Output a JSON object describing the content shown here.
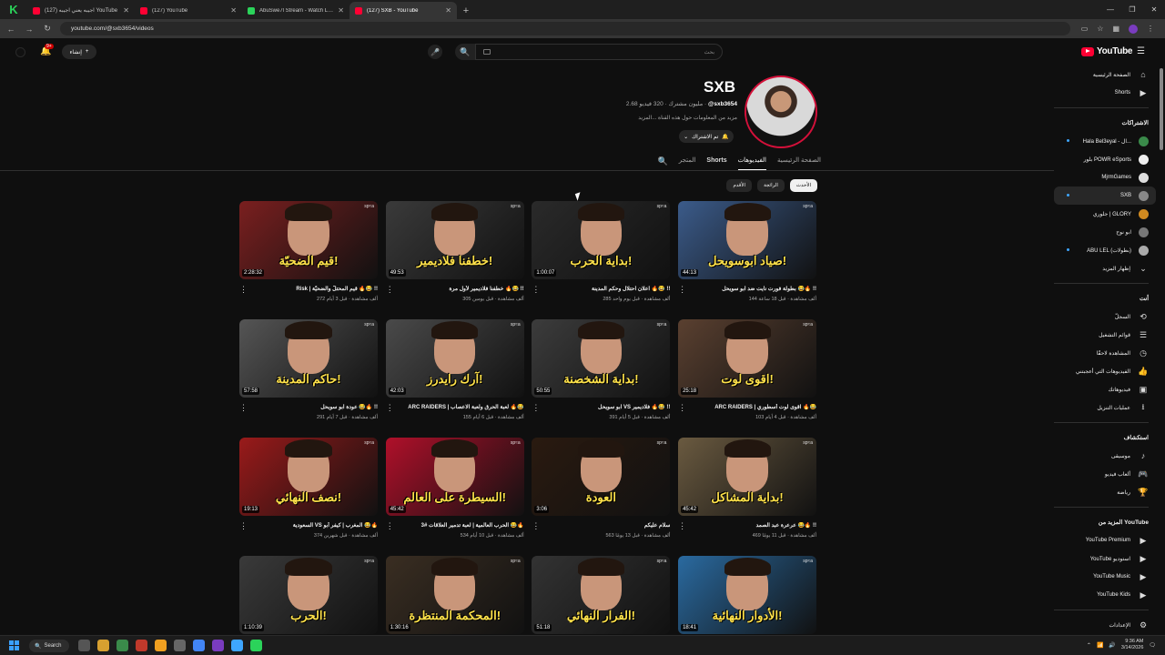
{
  "browser": {
    "tabs": [
      {
        "title": "اجيبه يعني اجيبه (127) YouTube",
        "active": false
      },
      {
        "title": "(127) YouTube",
        "active": false
      },
      {
        "title": "AbuSwe7l Stream - Watch Live",
        "active": false
      },
      {
        "title": "(127) SXB - YouTube",
        "active": true
      }
    ],
    "url": "youtube.com/@sxb3654/videos"
  },
  "header": {
    "create_label": "إنشاء",
    "notif_count": "9+",
    "search_placeholder": "بحث",
    "logo_text": "YouTube",
    "logo_sup": "SA"
  },
  "channel": {
    "name": "SXB",
    "handle": "@sxb3654",
    "stats": "2.68 مليون مشترك · 320 فيديو",
    "description": "مزيد من المعلومات حول هذه القناة ...المزيد",
    "subscribed_label": "تم الاشتراك",
    "tabs": [
      "الصفحة الرئيسية",
      "الفيديوهات",
      "Shorts",
      "المتجر"
    ],
    "active_tab": "الفيديوهات"
  },
  "filters": [
    "الأحدث",
    "الرائجة",
    "الأقدم"
  ],
  "videos": [
    {
      "title": "Risk | قيم المحتلّ والضحيّة 🔥😂 !!",
      "meta": "272 ألف مشاهدة · قبل 3 أيام",
      "duration": "2:28:32",
      "caption": "قيم الضحيّة!",
      "bg": "#7a1f1f"
    },
    {
      "title": "خطفنا فلاديمير لأول مرة 🔥😂 !!",
      "meta": "305 ألف مشاهدة · قبل يومين",
      "duration": "49:53",
      "caption": "خطفنا فلاديمير!",
      "bg": "#3a3a3a"
    },
    {
      "title": "اعلان احتلال وحكم المدينة 🔥😂 !!",
      "meta": "285 ألف مشاهدة · قبل يوم واحد",
      "duration": "1:00:07",
      "caption": "بداية الحرب!",
      "bg": "#2a2a2a"
    },
    {
      "title": "بطولة فورت نايت ضد ابو سويحل 😂🔥 !!",
      "meta": "144 ألف مشاهدة · قبل 18 ساعة",
      "duration": "44:13",
      "caption": "صياد ابوسويحل!",
      "bg": "#3b5b8a"
    },
    {
      "title": "عودة ابو سويحل 😂🔥 !!",
      "meta": "291 ألف مشاهدة · قبل 7 أيام",
      "duration": "57:58",
      "caption": "حاكم المدينة!",
      "bg": "#555555"
    },
    {
      "title": "ARC RAIDERS | لعبة الحرق ولعبة الاعصاب 🔥😂",
      "meta": "155 ألف مشاهدة · قبل 6 أيام",
      "duration": "42:03",
      "caption": "آرك رايدرز!",
      "bg": "#4a4a4a"
    },
    {
      "title": "ابو سويحل VS فلاديمير 🔥😂 !!",
      "meta": "391 ألف مشاهدة · قبل 5 أيام",
      "duration": "50:55",
      "caption": "بداية الشخصنة!",
      "bg": "#3c3c3c"
    },
    {
      "title": "ARC RAIDERS | اقوى لوت أسطوري 🔥😂",
      "meta": "103 ألف مشاهدة · قبل 4 أيام",
      "duration": "25:18",
      "caption": "اقوى لوت!",
      "bg": "#5a4030"
    },
    {
      "title": "السعودية VS المغرب | كيفر أبو 😂🔥",
      "meta": "374 ألف مشاهدة · قبل شهرين",
      "duration": "19:13",
      "caption": "نصف النهائي!",
      "bg": "#9a1a1a"
    },
    {
      "title": "3# الحرب العالمية | لعبة تدمير العلاقات 😂🔥",
      "meta": "534 ألف مشاهدة · قبل 10 أيام",
      "duration": "45:42",
      "caption": "السيطرة على العالم!",
      "bg": "#b0102a"
    },
    {
      "title": "سلام عليكم",
      "meta": "563 ألف مشاهدة · قبل 13 يومًا",
      "duration": "3:06",
      "caption": "العودة",
      "bg": "#2a1a10"
    },
    {
      "title": "عرعرة عبد الصمد 😂🔥 !!",
      "meta": "469 ألف مشاهدة · قبل 11 يومًا",
      "duration": "45:42",
      "caption": "بداية المشاكل!",
      "bg": "#6a5a40"
    },
    {
      "title": "",
      "meta": "",
      "duration": "1:10:39",
      "caption": "الحرب!",
      "bg": "#3a3a3a"
    },
    {
      "title": "",
      "meta": "",
      "duration": "1:30:16",
      "caption": "المحكمة المنتظرة!",
      "bg": "#3a2e22"
    },
    {
      "title": "",
      "meta": "",
      "duration": "51:18",
      "caption": "الفرار النهائي!",
      "bg": "#333333"
    },
    {
      "title": "",
      "meta": "",
      "duration": "18:41",
      "caption": "الأدوار النهائية!",
      "bg": "#2a6aa0"
    }
  ],
  "sidebar": {
    "main": [
      {
        "label": "الصفحة الرئيسية",
        "icon": "home-icon"
      },
      {
        "label": "Shorts",
        "icon": "shorts-icon"
      }
    ],
    "subs_title": "الاشتراكات",
    "subs": [
      {
        "label": "Hala Bel3eyal - ال...",
        "dot": true,
        "color": "#3a8a4a"
      },
      {
        "label": "بلور POWR eSports",
        "dot": false,
        "color": "#eeeeee"
      },
      {
        "label": "MjrmGames",
        "dot": false,
        "color": "#dddddd"
      },
      {
        "label": "SXB",
        "dot": true,
        "color": "#888888",
        "selected": true
      },
      {
        "label": "جلوري | GLORY",
        "dot": false,
        "color": "#d08a20"
      },
      {
        "label": "ابو نوح",
        "dot": false,
        "color": "#777777"
      },
      {
        "label": "ABU LEL (بطولات)",
        "dot": true,
        "color": "#aaaaaa"
      }
    ],
    "show_more": "إظهار المزيد",
    "you_title": "أنت",
    "you": [
      {
        "label": "السجلّ",
        "icon": "history-icon"
      },
      {
        "label": "قوائم التشغيل",
        "icon": "playlist-icon"
      },
      {
        "label": "المشاهدة لاحقًا",
        "icon": "clock-icon"
      },
      {
        "label": "الفيديوهات التي أعجبتني",
        "icon": "like-icon"
      },
      {
        "label": "فيديوهاتك",
        "icon": "video-icon"
      },
      {
        "label": "عمليات التنزيل",
        "icon": "download-icon"
      }
    ],
    "explore_title": "استكشاف",
    "explore": [
      {
        "label": "موسيقى",
        "icon": "music-icon"
      },
      {
        "label": "ألعاب فيديو",
        "icon": "gaming-icon"
      },
      {
        "label": "رياضة",
        "icon": "trophy-icon"
      }
    ],
    "more_title": "المزيد من YouTube",
    "more": [
      {
        "label": "YouTube Premium"
      },
      {
        "label": "YouTube استوديو"
      },
      {
        "label": "YouTube Music"
      },
      {
        "label": "YouTube Kids"
      }
    ],
    "settings": "الإعدادات"
  },
  "taskbar": {
    "search_label": "Search",
    "time": "9:36 AM",
    "date": "3/14/2026"
  },
  "colors": {
    "accent": "#ff0033",
    "bg": "#0f0f0f",
    "chip_active": "#f1f1f1"
  }
}
